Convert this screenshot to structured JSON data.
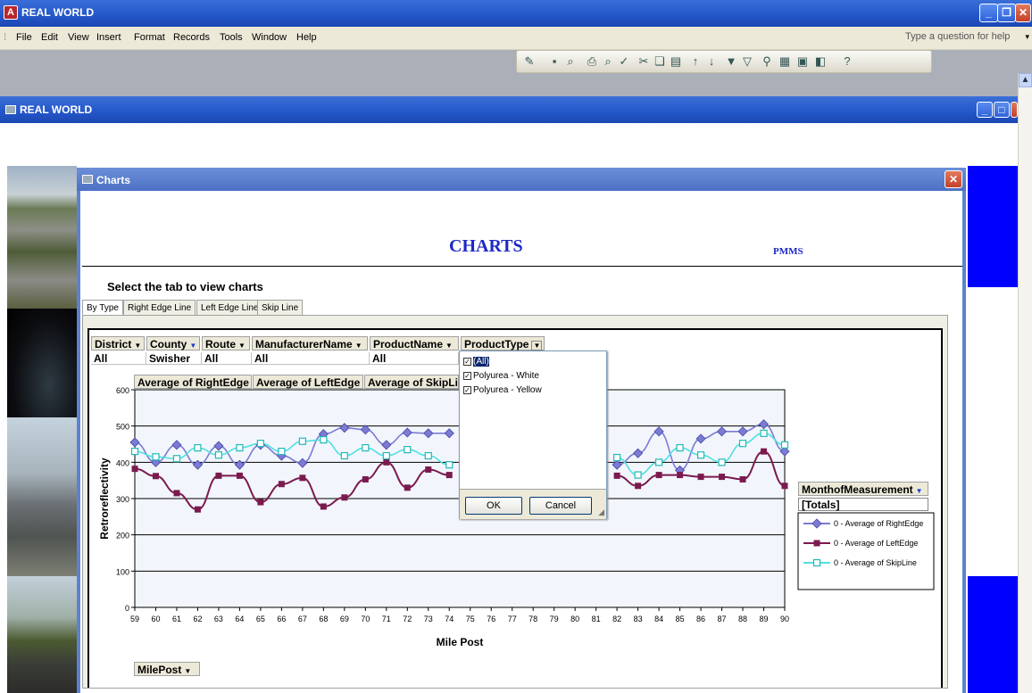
{
  "app": {
    "title": "REAL WORLD",
    "menu": [
      "File",
      "Edit",
      "View",
      "Insert",
      "Format",
      "Records",
      "Tools",
      "Window",
      "Help"
    ],
    "help_placeholder": "Type a question for help"
  },
  "inner_window": {
    "title": "REAL WORLD"
  },
  "dialog": {
    "title": "Charts",
    "heading": "CHARTS",
    "brand": "PMMS",
    "instruction": "Select the tab to view charts",
    "tabs": [
      "By Type",
      "Right Edge Line",
      "Left Edge Line",
      "Skip Line"
    ],
    "active_tab": "By Type"
  },
  "pivot": {
    "filters": [
      {
        "name": "District",
        "value": "All"
      },
      {
        "name": "County",
        "value": "Swisher"
      },
      {
        "name": "Route",
        "value": "All"
      },
      {
        "name": "ManufacturerName",
        "value": "All"
      },
      {
        "name": "ProductName",
        "value": "All"
      },
      {
        "name": "ProductType",
        "value": ""
      }
    ],
    "data_fields": [
      "Average of RightEdge",
      "Average of LeftEdge",
      "Average of SkipLi"
    ],
    "series_field": "MonthofMeasurement",
    "series_value": "[Totals]",
    "category_field": "MilePost"
  },
  "dropdown": {
    "items": [
      {
        "label": "(All)",
        "checked": true,
        "selected": true
      },
      {
        "label": "Polyurea - White",
        "checked": true,
        "selected": false
      },
      {
        "label": "Polyurea - Yellow",
        "checked": true,
        "selected": false
      }
    ],
    "ok_label": "OK",
    "cancel_label": "Cancel"
  },
  "chart_data": {
    "type": "line",
    "xlabel": "Mile Post",
    "ylabel": "Retroreflectivity",
    "ylim": [
      0,
      600
    ],
    "yticks": [
      0,
      100,
      200,
      300,
      400,
      500,
      600
    ],
    "grid": true,
    "legend_position": "right",
    "x": [
      59,
      60,
      61,
      62,
      63,
      64,
      65,
      66,
      67,
      68,
      69,
      70,
      71,
      72,
      73,
      74,
      75,
      76,
      77,
      78,
      79,
      80,
      81,
      82,
      83,
      84,
      85,
      86,
      87,
      88,
      89,
      90
    ],
    "series": [
      {
        "name": "0 - Average of RightEdge",
        "color": "#7b7bd4",
        "marker": "diamond",
        "values": [
          455,
          400,
          448,
          393,
          445,
          393,
          448,
          418,
          398,
          478,
          495,
          490,
          448,
          482,
          480,
          480,
          null,
          null,
          null,
          null,
          null,
          null,
          null,
          393,
          425,
          485,
          378,
          465,
          485,
          485,
          505,
          430
        ]
      },
      {
        "name": "0 - Average of LeftEdge",
        "color": "#7b1a4e",
        "marker": "square",
        "values": [
          382,
          362,
          315,
          270,
          363,
          363,
          290,
          340,
          357,
          278,
          303,
          353,
          400,
          330,
          380,
          365,
          null,
          null,
          null,
          null,
          null,
          null,
          null,
          363,
          335,
          365,
          365,
          360,
          360,
          353,
          430,
          335
        ]
      },
      {
        "name": "0 - Average of SkipLine",
        "color": "#4fe0e0",
        "marker": "square-open",
        "values": [
          430,
          415,
          410,
          440,
          420,
          440,
          452,
          430,
          458,
          462,
          418,
          440,
          418,
          435,
          418,
          393,
          null,
          null,
          null,
          null,
          null,
          null,
          null,
          413,
          365,
          400,
          440,
          420,
          400,
          452,
          480,
          448
        ]
      }
    ]
  }
}
